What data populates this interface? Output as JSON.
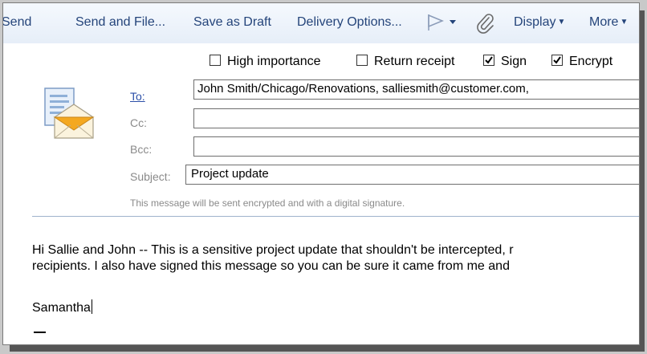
{
  "toolbar": {
    "send": "Send",
    "send_and_file": "Send and File...",
    "save_as_draft": "Save as Draft",
    "delivery_options": "Delivery Options...",
    "display": "Display",
    "more": "More"
  },
  "options": {
    "high_importance": {
      "label": "High importance",
      "checked": false
    },
    "return_receipt": {
      "label": "Return receipt",
      "checked": false
    },
    "sign": {
      "label": "Sign",
      "checked": true
    },
    "encrypt": {
      "label": "Encrypt",
      "checked": true
    }
  },
  "header": {
    "to_label": "To:",
    "to_value": "John Smith/Chicago/Renovations, salliesmith@customer.com,",
    "cc_label": "Cc:",
    "cc_value": "",
    "bcc_label": "Bcc:",
    "bcc_value": "",
    "subject_label": "Subject:",
    "subject_value": "Project update",
    "security_note": "This message will be sent encrypted and with a digital signature."
  },
  "body": {
    "line1": "Hi Sallie and John -- This is a sensitive project update that shouldn't be intercepted, r",
    "line2": "recipients.  I also have signed this message so you can be sure it came from me and",
    "signature": "Samantha"
  },
  "icons": {
    "flag": "flag-icon",
    "attach": "paperclip-icon",
    "message": "envelope-document-icon"
  },
  "colors": {
    "toolbar_text": "#24447a",
    "link": "#2b4fa8",
    "label_gray": "#8a8a8a",
    "separator": "#9fb2cc"
  }
}
